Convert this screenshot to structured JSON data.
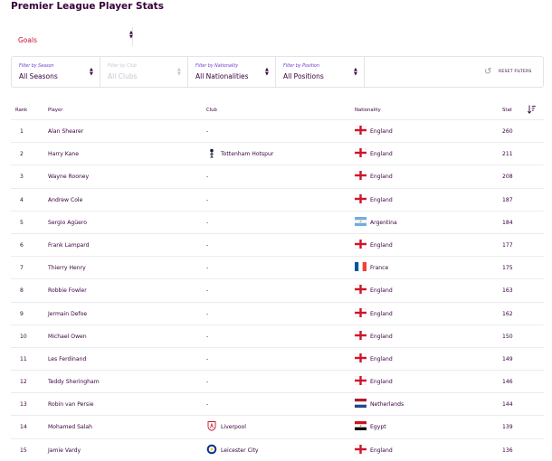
{
  "page": {
    "title": "Premier League Player Stats"
  },
  "stat_selector": {
    "value": "Goals",
    "arrow_icon": "chevron-updown-icon"
  },
  "filters": [
    {
      "label": "Filter by Season",
      "value": "All Seasons",
      "disabled": false
    },
    {
      "label": "Filter by Club",
      "value": "All Clubs",
      "disabled": true
    },
    {
      "label": "Filter by Nationality",
      "value": "All Nationalities",
      "disabled": false
    },
    {
      "label": "Filter by Position",
      "value": "All Positions",
      "disabled": false
    }
  ],
  "reset": {
    "label": "RESET FILTERS",
    "icon": "reset-icon"
  },
  "table": {
    "headers": {
      "rank": "Rank",
      "player": "Player",
      "club": "Club",
      "nationality": "Nationality",
      "stat": "Stat"
    },
    "sort_icon": "sort-descending-icon",
    "rows": [
      {
        "rank": "1",
        "player": "Alan Shearer",
        "club": "-",
        "club_badge": "",
        "nationality": "England",
        "flag": "england",
        "stat": "260"
      },
      {
        "rank": "2",
        "player": "Harry Kane",
        "club": "Tottenham Hotspur",
        "club_badge": "tottenham-badge",
        "nationality": "England",
        "flag": "england",
        "stat": "211"
      },
      {
        "rank": "3",
        "player": "Wayne Rooney",
        "club": "-",
        "club_badge": "",
        "nationality": "England",
        "flag": "england",
        "stat": "208"
      },
      {
        "rank": "4",
        "player": "Andrew Cole",
        "club": "-",
        "club_badge": "",
        "nationality": "England",
        "flag": "england",
        "stat": "187"
      },
      {
        "rank": "5",
        "player": "Sergio Agüero",
        "club": "-",
        "club_badge": "",
        "nationality": "Argentina",
        "flag": "argentina",
        "stat": "184"
      },
      {
        "rank": "6",
        "player": "Frank Lampard",
        "club": "-",
        "club_badge": "",
        "nationality": "England",
        "flag": "england",
        "stat": "177"
      },
      {
        "rank": "7",
        "player": "Thierry Henry",
        "club": "-",
        "club_badge": "",
        "nationality": "France",
        "flag": "france",
        "stat": "175"
      },
      {
        "rank": "8",
        "player": "Robbie Fowler",
        "club": "-",
        "club_badge": "",
        "nationality": "England",
        "flag": "england",
        "stat": "163"
      },
      {
        "rank": "9",
        "player": "Jermain Defoe",
        "club": "-",
        "club_badge": "",
        "nationality": "England",
        "flag": "england",
        "stat": "162"
      },
      {
        "rank": "10",
        "player": "Michael Owen",
        "club": "-",
        "club_badge": "",
        "nationality": "England",
        "flag": "england",
        "stat": "150"
      },
      {
        "rank": "11",
        "player": "Les Ferdinand",
        "club": "-",
        "club_badge": "",
        "nationality": "England",
        "flag": "england",
        "stat": "149"
      },
      {
        "rank": "12",
        "player": "Teddy Sheringham",
        "club": "-",
        "club_badge": "",
        "nationality": "England",
        "flag": "england",
        "stat": "146"
      },
      {
        "rank": "13",
        "player": "Robin van Persie",
        "club": "-",
        "club_badge": "",
        "nationality": "Netherlands",
        "flag": "netherlands",
        "stat": "144"
      },
      {
        "rank": "14",
        "player": "Mohamed Salah",
        "club": "Liverpool",
        "club_badge": "liverpool-badge",
        "nationality": "Egypt",
        "flag": "egypt",
        "stat": "139"
      },
      {
        "rank": "15",
        "player": "Jamie Vardy",
        "club": "Leicester City",
        "club_badge": "leicester-badge",
        "nationality": "England",
        "flag": "england",
        "stat": "136"
      }
    ]
  }
}
